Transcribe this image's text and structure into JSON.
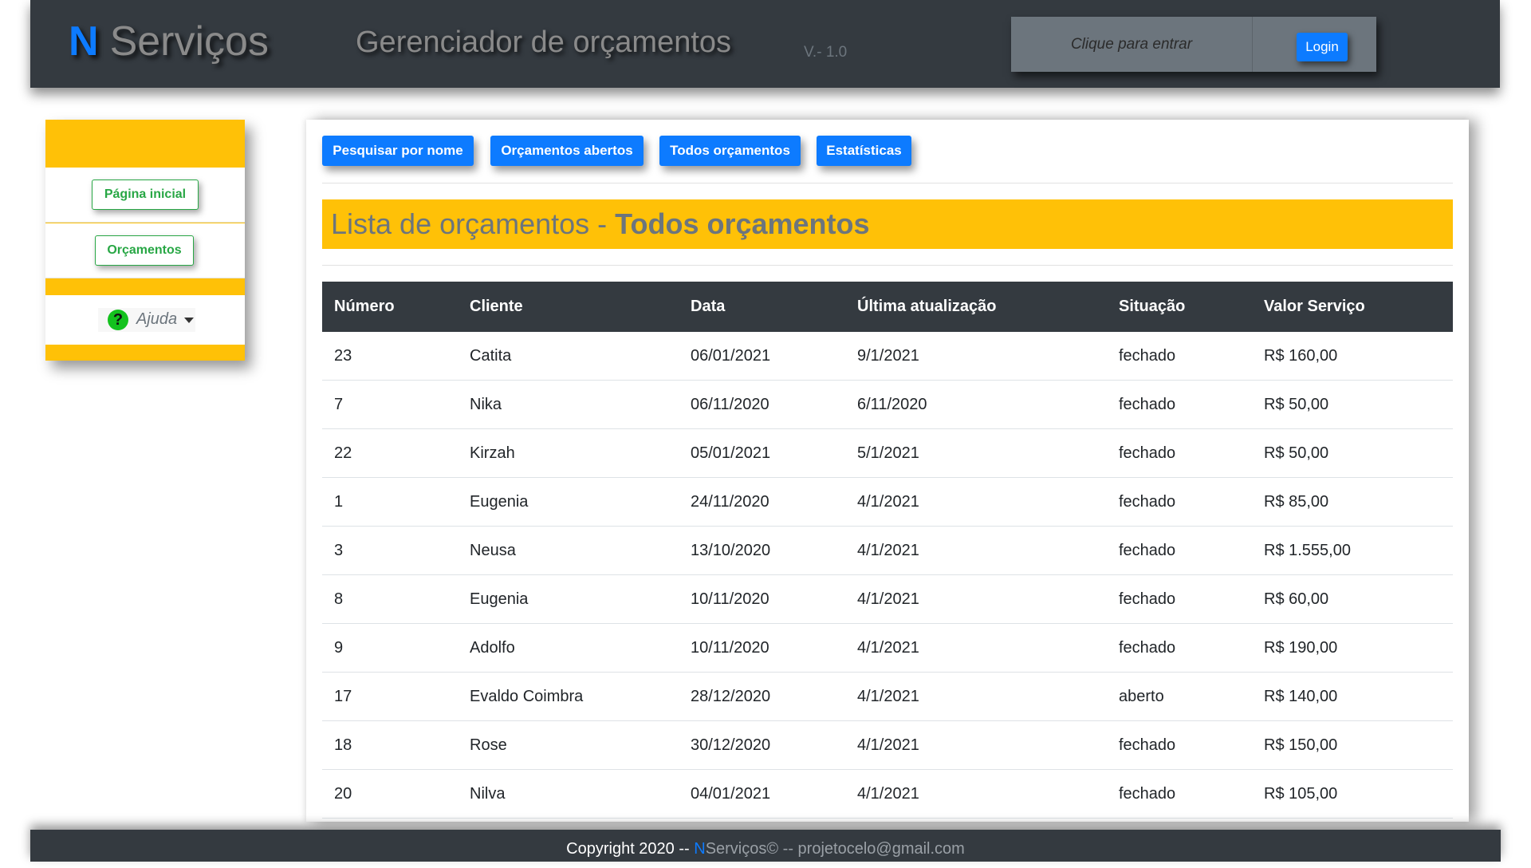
{
  "header": {
    "brand_letter": "N",
    "brand_name": "Serviços",
    "subtitle": "Gerenciador de orçamentos",
    "version": "V.- 1.0",
    "login_placeholder": "Clique para entrar",
    "login_button": "Login"
  },
  "sidebar": {
    "items": [
      {
        "label": "Página inicial"
      },
      {
        "label": "Orçamentos"
      }
    ],
    "help_label": "Ajuda",
    "help_icon": "?"
  },
  "tabs": [
    {
      "label": "Pesquisar por nome"
    },
    {
      "label": "Orçamentos abertos"
    },
    {
      "label": "Todos orçamentos"
    },
    {
      "label": "Estatísticas"
    }
  ],
  "list": {
    "title_prefix": "Lista de orçamentos - ",
    "title_bold": "Todos orçamentos"
  },
  "table": {
    "headers": [
      "Número",
      "Cliente",
      "Data",
      "Última atualização",
      "Situação",
      "Valor Serviço"
    ],
    "rows": [
      [
        "23",
        "Catita",
        "06/01/2021",
        "9/1/2021",
        "fechado",
        "R$ 160,00"
      ],
      [
        "7",
        "Nika",
        "06/11/2020",
        "6/11/2020",
        "fechado",
        "R$ 50,00"
      ],
      [
        "22",
        "Kirzah",
        "05/01/2021",
        "5/1/2021",
        "fechado",
        "R$ 50,00"
      ],
      [
        "1",
        "Eugenia",
        "24/11/2020",
        "4/1/2021",
        "fechado",
        "R$ 85,00"
      ],
      [
        "3",
        "Neusa",
        "13/10/2020",
        "4/1/2021",
        "fechado",
        "R$ 1.555,00"
      ],
      [
        "8",
        "Eugenia",
        "10/11/2020",
        "4/1/2021",
        "fechado",
        "R$ 60,00"
      ],
      [
        "9",
        "Adolfo",
        "10/11/2020",
        "4/1/2021",
        "fechado",
        "R$ 190,00"
      ],
      [
        "17",
        "Evaldo Coimbra",
        "28/12/2020",
        "4/1/2021",
        "aberto",
        "R$ 140,00"
      ],
      [
        "18",
        "Rose",
        "30/12/2020",
        "4/1/2021",
        "fechado",
        "R$ 150,00"
      ],
      [
        "20",
        "Nilva",
        "04/01/2021",
        "4/1/2021",
        "fechado",
        "R$ 105,00"
      ]
    ]
  },
  "footer": {
    "prefix": "Copyright 2020 -- ",
    "brand_letter": "N",
    "brand_rest": "Serviços© -- projetocelo@gmail.com"
  },
  "colors": {
    "primary": "#0d7bff",
    "warning": "#ffc107",
    "dark": "#343a40",
    "success": "#28a745",
    "help_icon": "#14c21e"
  }
}
